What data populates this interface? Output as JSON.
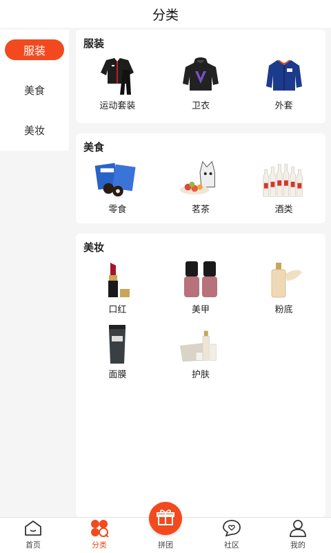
{
  "header": {
    "title": "分类"
  },
  "sidebar": {
    "items": [
      {
        "label": "服装",
        "active": true
      },
      {
        "label": "美食",
        "active": false
      },
      {
        "label": "美妆",
        "active": false
      }
    ]
  },
  "sections": [
    {
      "title": "服装",
      "items": [
        {
          "label": "运动套装",
          "icon": "tracksuit-icon"
        },
        {
          "label": "卫衣",
          "icon": "hoodie-icon"
        },
        {
          "label": "外套",
          "icon": "jacket-icon"
        }
      ]
    },
    {
      "title": "美食",
      "items": [
        {
          "label": "零食",
          "icon": "snack-icon"
        },
        {
          "label": "茗茶",
          "icon": "tea-icon"
        },
        {
          "label": "酒类",
          "icon": "liquor-icon"
        }
      ]
    },
    {
      "title": "美妆",
      "items": [
        {
          "label": "口红",
          "icon": "lipstick-icon"
        },
        {
          "label": "美甲",
          "icon": "nail-polish-icon"
        },
        {
          "label": "粉底",
          "icon": "foundation-icon"
        },
        {
          "label": "面膜",
          "icon": "facial-mask-icon"
        },
        {
          "label": "护肤",
          "icon": "skincare-icon"
        }
      ]
    }
  ],
  "tabbar": {
    "items": [
      {
        "label": "首页",
        "icon": "home-icon"
      },
      {
        "label": "分类",
        "icon": "category-icon",
        "active": true
      },
      {
        "label": "拼团",
        "icon": "gift-icon"
      },
      {
        "label": "社区",
        "icon": "community-icon"
      },
      {
        "label": "我的",
        "icon": "profile-icon"
      }
    ]
  },
  "colors": {
    "accent": "#f24a1e",
    "background": "#f5f5f5"
  }
}
